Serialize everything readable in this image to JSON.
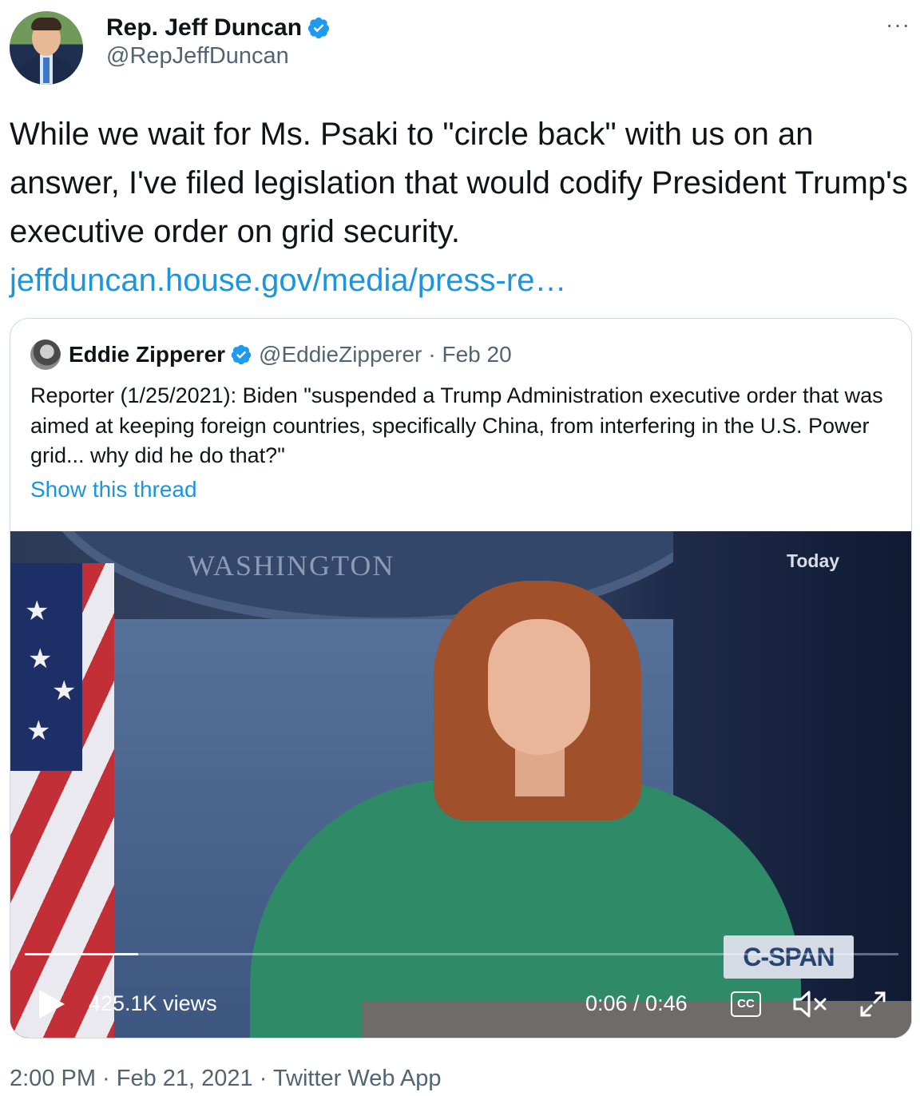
{
  "author": {
    "display_name": "Rep. Jeff Duncan",
    "handle": "@RepJeffDuncan"
  },
  "more_menu": "···",
  "tweet": {
    "text": "While we wait for Ms. Psaki to \"circle back\" with us on an answer, I've filed legislation that would codify President Trump's executive order on grid security.",
    "link_text": "jeffduncan.house.gov/media/press-re…"
  },
  "quoted_tweet": {
    "display_name": "Eddie Zipperer",
    "handle": "@EddieZipperer",
    "date": "· Feb 20",
    "text": "Reporter (1/25/2021): Biden \"suspended a Trump Administration executive order that was aimed at keeping foreign countries, specifically China, from interfering in the U.S. Power grid... why did he do that?\"",
    "show_thread": "Show this thread"
  },
  "video": {
    "backdrop_text": "WASHINGTON",
    "overlay_label": "Today",
    "network_logo": "C-SPAN",
    "views": "425.1K views",
    "time": "0:06 / 0:46",
    "cc_label": "CC",
    "progress_fraction": 0.13
  },
  "footer": {
    "timestamp": "2:00 PM · Feb 21, 2021 · Twitter Web App"
  },
  "colors": {
    "link": "#1b95e0",
    "verified": "#1d9bf0",
    "muted_text": "#536471",
    "border": "#cfd9de"
  }
}
